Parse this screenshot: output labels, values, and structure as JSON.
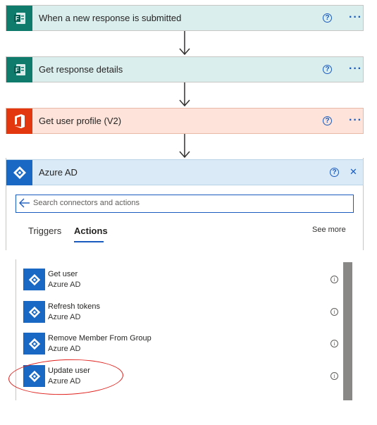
{
  "steps": [
    {
      "title": "When a new response is submitted",
      "icon": "forms-icon"
    },
    {
      "title": "Get response details",
      "icon": "forms-icon"
    },
    {
      "title": "Get user profile (V2)",
      "icon": "office-icon"
    }
  ],
  "azure": {
    "title": "Azure AD",
    "search_placeholder": "Search connectors and actions",
    "tabs": [
      "Triggers",
      "Actions"
    ],
    "active_tab": "Actions",
    "see_more": "See more",
    "actions": [
      {
        "name": "Get user",
        "connector": "Azure AD"
      },
      {
        "name": "Refresh tokens",
        "connector": "Azure AD"
      },
      {
        "name": "Remove Member From Group",
        "connector": "Azure AD"
      },
      {
        "name": "Update user",
        "connector": "Azure AD"
      }
    ]
  },
  "colors": {
    "accent": "#1a5bc0",
    "forms_tile": "#0f7b6c",
    "office_tile": "#e3380f",
    "azure_tile": "#1868c4",
    "highlight": "#e0201c"
  },
  "glyphs": {
    "help": "?",
    "more": "···",
    "info": "i",
    "close": "✕"
  }
}
